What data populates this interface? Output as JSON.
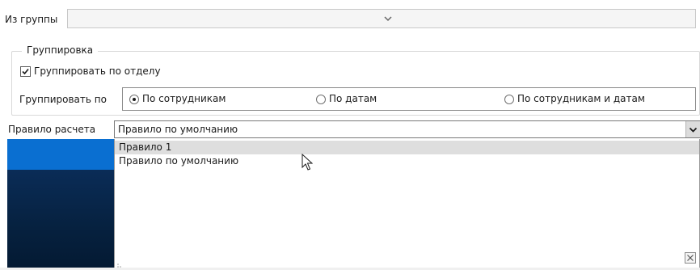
{
  "from_group": {
    "label": "Из группы",
    "value": ""
  },
  "grouping": {
    "legend": "Группировка",
    "group_by_dept_label": "Группировать по отделу",
    "group_by_label": "Группировать по",
    "options": [
      "По сотрудникам",
      "По датам",
      "По сотрудникам и датам"
    ],
    "selected_option": "По сотрудникам"
  },
  "calc_rule": {
    "label": "Правило расчета",
    "value": "Правило по умолчанию",
    "dropdown_items": [
      "Правило 1",
      "Правило по умолчанию"
    ],
    "highlighted_item": "Правило 1"
  },
  "icons": {
    "chevron": "chevron-down-icon",
    "close": "close-icon",
    "cursor": "mouse-pointer-icon",
    "grip": "resize-grip-icon"
  }
}
